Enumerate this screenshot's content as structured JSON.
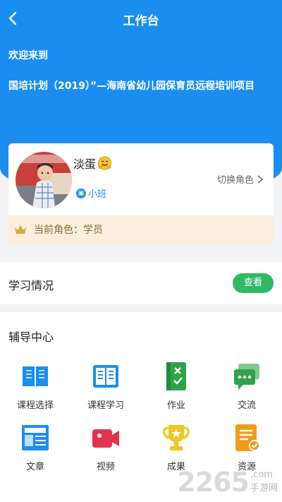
{
  "nav": {
    "title": "工作台",
    "back_icon": "chevron-left-icon"
  },
  "hero": {
    "welcome": "欢迎来到",
    "project_title": "国培计划（2019）”—海南省幼儿园保育员远程培训项目"
  },
  "profile": {
    "username": "淡蛋",
    "emoji_icon": "hugging-face-emoji",
    "class_name": "小班",
    "switch_role_label": "切换角色",
    "current_role_label": "当前角色：学员"
  },
  "study": {
    "title": "学习情况",
    "view_button": "查看"
  },
  "tutor": {
    "title": "辅导中心",
    "items": [
      {
        "label": "课程选择",
        "icon": "open-book-icon"
      },
      {
        "label": "课程学习",
        "icon": "book-study-icon"
      },
      {
        "label": "作业",
        "icon": "homework-icon"
      },
      {
        "label": "交流",
        "icon": "chat-icon"
      },
      {
        "label": "文章",
        "icon": "article-icon"
      },
      {
        "label": "视频",
        "icon": "video-camera-icon"
      },
      {
        "label": "成果",
        "icon": "trophy-icon"
      },
      {
        "label": "资源",
        "icon": "resource-doc-icon"
      }
    ]
  },
  "watermark": {
    "number": "2265",
    "suffix": ".com",
    "text": "手游网"
  },
  "colors": {
    "primary": "#1a8ef0",
    "green": "#2fb965",
    "role_bar_bg": "#fbeedd",
    "role_text": "#8a6a3b"
  }
}
